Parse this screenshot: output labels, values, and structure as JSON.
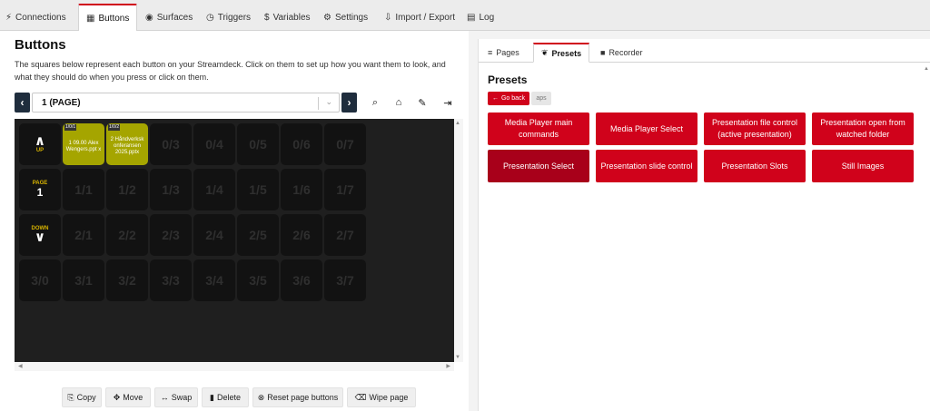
{
  "topnav": {
    "tabs": [
      {
        "label": "Connections",
        "icon": "plug-icon",
        "glyph": "⚡"
      },
      {
        "label": "Buttons",
        "icon": "grid-icon",
        "glyph": "▦"
      },
      {
        "label": "Surfaces",
        "icon": "gamepad-icon",
        "glyph": "◉"
      },
      {
        "label": "Triggers",
        "icon": "clock-icon",
        "glyph": "◷"
      },
      {
        "label": "Variables",
        "icon": "dollar-icon",
        "glyph": "$"
      },
      {
        "label": "Settings",
        "icon": "gear-icon",
        "glyph": "⚙"
      },
      {
        "label": "Import / Export",
        "icon": "file-import-icon",
        "glyph": "⇩"
      },
      {
        "label": "Log",
        "icon": "clipboard-icon",
        "glyph": "▤"
      }
    ]
  },
  "buttons_panel": {
    "title": "Buttons",
    "description": "The squares below represent each button on your Streamdeck. Click on them to set up how you want them to look, and what they should do when you press or click on them.",
    "page_select": "1 (PAGE)",
    "prev_glyph": "‹",
    "next_glyph": "›",
    "chevron_glyph": "⌄",
    "tools": {
      "search": "⌕",
      "home": "⌂",
      "edit": "✎",
      "export": "⇥"
    },
    "grid": {
      "nav": {
        "up_label": "UP",
        "up_arrow": "∧",
        "page_label": "PAGE",
        "page_number": "1",
        "down_label": "DOWN",
        "down_arrow": "∨"
      },
      "yellow": [
        {
          "idx": "1/0/1",
          "text": "1 09.00 Alex Wengers.ppt x"
        },
        {
          "idx": "1/0/2",
          "text": "2 Håndverksk onferansen 2025.pptx"
        }
      ],
      "rows": [
        [
          "",
          "",
          "",
          "0/3",
          "0/4",
          "0/5",
          "0/6",
          "0/7"
        ],
        [
          "",
          "1/1",
          "1/2",
          "1/3",
          "1/4",
          "1/5",
          "1/6",
          "1/7"
        ],
        [
          "",
          "2/1",
          "2/2",
          "2/3",
          "2/4",
          "2/5",
          "2/6",
          "2/7"
        ],
        [
          "3/0",
          "3/1",
          "3/2",
          "3/3",
          "3/4",
          "3/5",
          "3/6",
          "3/7"
        ]
      ]
    },
    "actions": [
      {
        "label": "Copy",
        "glyph": "⎘"
      },
      {
        "label": "Move",
        "glyph": "✥"
      },
      {
        "label": "Swap",
        "glyph": "↔"
      },
      {
        "label": "Delete",
        "glyph": "▮"
      },
      {
        "label": "Reset page buttons",
        "glyph": "⊗"
      },
      {
        "label": "Wipe page",
        "glyph": "⌫"
      }
    ]
  },
  "right_panel": {
    "tabs": [
      {
        "label": "Pages",
        "glyph": "≡"
      },
      {
        "label": "Presets",
        "glyph": "❦"
      },
      {
        "label": "Recorder",
        "glyph": "■"
      }
    ],
    "title": "Presets",
    "go_back": "Go back",
    "go_back_glyph": "←",
    "crumb": "aps",
    "presets": [
      "Media Player main commands",
      "Media Player Select",
      "Presentation file control (active presentation)",
      "Presentation open from watched folder",
      "Presentation Select",
      "Presentation slide control",
      "Presentation Slots",
      "Still Images"
    ]
  },
  "colors": {
    "accent": "#d0021b",
    "accent_selected": "#a8001a",
    "grid_bg": "#1f1f1f",
    "button_bg": "#121212",
    "loaded_button": "#a5a500"
  }
}
